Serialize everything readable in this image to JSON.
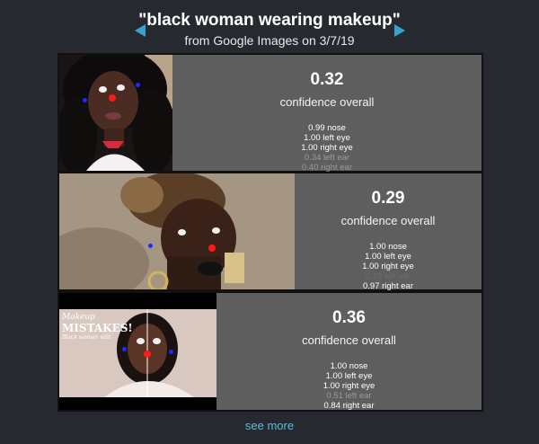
{
  "header": {
    "title": "\"black woman wearing makeup\"",
    "subtitle": "from Google Images on 3/7/19"
  },
  "colors": {
    "background": "#262a30",
    "panel": "#5e5e5e",
    "arrow": "#3aa0cf",
    "link": "#5fb8e0",
    "nose_marker": "#ff1a1a",
    "ear_marker": "#1e2bff"
  },
  "results": [
    {
      "score": "0.32",
      "label": "confidence overall",
      "parts": [
        {
          "text": "0.99 nose"
        },
        {
          "text": "1.00 left eye"
        },
        {
          "text": "1.00 right eye"
        },
        {
          "text": "0.34 left ear"
        },
        {
          "text": "0.40 right ear"
        }
      ]
    },
    {
      "score": "0.29",
      "label": "confidence overall",
      "parts": [
        {
          "text": "1.00 nose"
        },
        {
          "text": "1.00 left eye"
        },
        {
          "text": "1.00 right eye"
        },
        {
          "text": "0.13 left ear"
        },
        {
          "text": "0.97 right ear"
        }
      ]
    },
    {
      "score": "0.36",
      "label": "confidence overall",
      "image_caption": {
        "line1": "Makeup",
        "line2": "MISTAKES!",
        "line3": "Black women edit"
      },
      "parts": [
        {
          "text": "1.00 nose"
        },
        {
          "text": "1.00 left eye"
        },
        {
          "text": "1.00 right eye"
        },
        {
          "text": "0.51 left ear"
        },
        {
          "text": "0.84 right ear"
        }
      ]
    }
  ],
  "footer": {
    "see_more": "see more"
  }
}
